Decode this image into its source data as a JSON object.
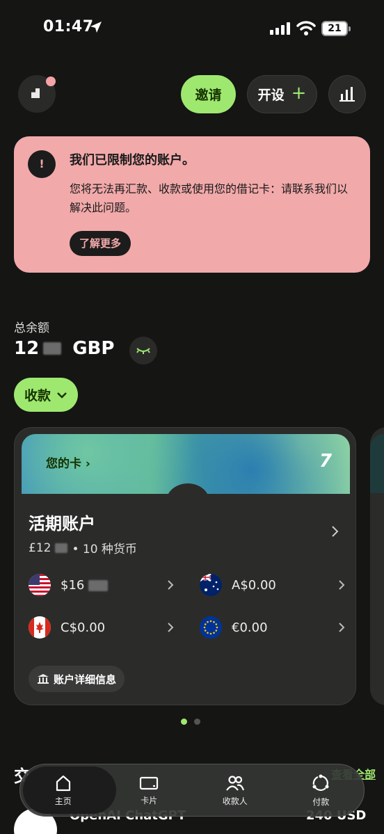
{
  "status_bar": {
    "time": "01:47",
    "battery": "21"
  },
  "top_bar": {
    "invite_label": "邀请",
    "open_label": "开设",
    "open_plus": "+"
  },
  "alert": {
    "icon": "!",
    "title": "我们已限制您的账户。",
    "body": "您将无法再汇款、收款或使用您的借记卡：请联系我们以解决此问题。",
    "button_label": "了解更多"
  },
  "balance": {
    "label": "总余额",
    "amount_prefix": "12",
    "currency": "GBP"
  },
  "receive_button": {
    "label": "收款"
  },
  "card": {
    "your_card_label": "您的卡",
    "your_card_chevron": "›",
    "logo": "7",
    "account_title": "活期账户",
    "account_amount_prefix": "£12",
    "account_currencies": "• 10 种货币",
    "currencies": [
      {
        "flag": "us-flag-icon",
        "amount": "$16"
      },
      {
        "flag": "au-flag-icon",
        "amount": "A$0.00"
      },
      {
        "flag": "ca-flag-icon",
        "amount": "C$0.00"
      },
      {
        "flag": "eu-flag-icon",
        "amount": "€0.00"
      }
    ],
    "details_button": "账户详细信息"
  },
  "pager": {
    "active": 0,
    "count": 2
  },
  "transactions": {
    "title": "交",
    "see_all": "查看全部",
    "first": {
      "name": "OpenAI ChatGPT",
      "amount": "240 USD"
    }
  },
  "nav": [
    {
      "label": "主页",
      "icon": "home-icon"
    },
    {
      "label": "卡片",
      "icon": "card-icon"
    },
    {
      "label": "收款人",
      "icon": "recipients-icon"
    },
    {
      "label": "付款",
      "icon": "payments-icon"
    }
  ],
  "colors": {
    "accent": "#9fe870",
    "alert_bg": "#f2a9aa",
    "background": "#151514"
  }
}
